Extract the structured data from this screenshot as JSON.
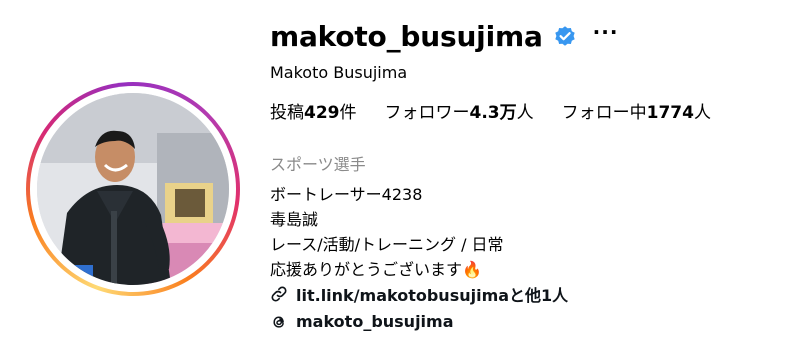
{
  "profile": {
    "username": "makoto_busujima",
    "more_label": "···",
    "full_name": "Makoto Busujima",
    "stats": {
      "posts_label": "投稿",
      "posts_count": "429",
      "posts_unit": "件",
      "followers_label": "フォロワー",
      "followers_count": "4.3万",
      "followers_unit": "人",
      "following_label": "フォロー中",
      "following_count": "1774",
      "following_unit": "人"
    },
    "category": "スポーツ選手",
    "bio": [
      "ボートレーサー4238",
      "毒島誠",
      "レース/活動/トレーニング / 日常",
      "応援ありがとうございます"
    ],
    "bio_emoji": "🔥",
    "link": {
      "text": "lit.link/makotobusujimaと他1人",
      "icon": "link-icon"
    },
    "threads": {
      "handle": "makoto_busujima",
      "icon": "threads-icon"
    },
    "colors": {
      "verified": "#3897f0",
      "category": "#8a8a8a"
    }
  }
}
